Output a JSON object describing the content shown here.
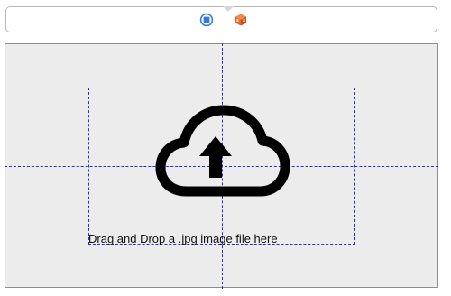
{
  "scene_dock": {
    "icons": [
      {
        "name": "view-controller-icon",
        "color": "#2e7dde"
      },
      {
        "name": "cube-icon",
        "color": "#e8692c"
      }
    ]
  },
  "drop_zone": {
    "icon": "cloud-upload-icon",
    "label": "Drag and Drop a .jpg image file here"
  },
  "colors": {
    "background": "#ececec",
    "guides": "#2b2bd0",
    "icon": "#000000"
  }
}
